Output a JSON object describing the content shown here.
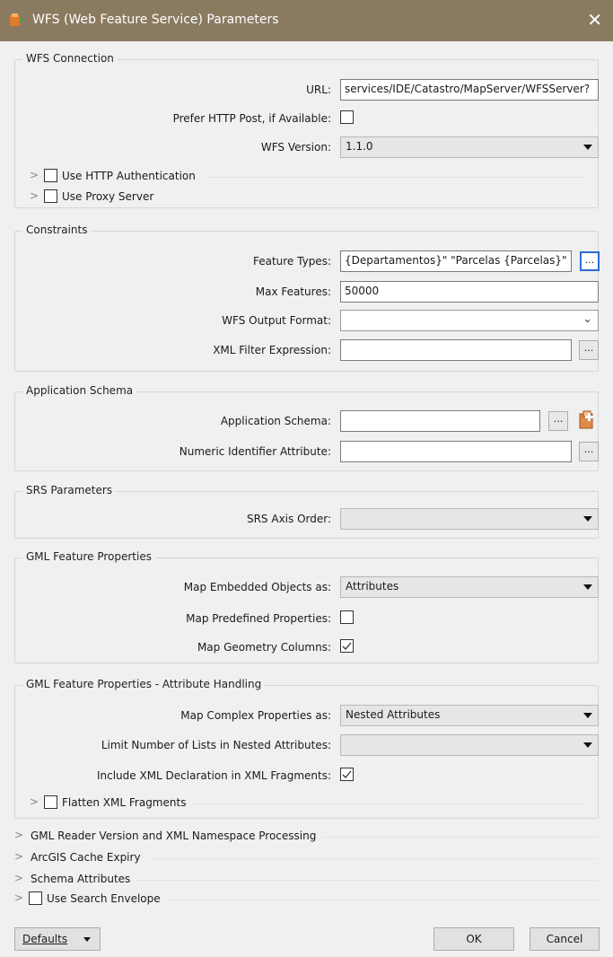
{
  "window": {
    "title": "WFS (Web Feature Service) Parameters",
    "close_glyph": "✕"
  },
  "wfs_connection": {
    "title": "WFS Connection",
    "url_label": "URL:",
    "url_value": "services/IDE/Catastro/MapServer/WFSServer?",
    "prefer_post_label": "Prefer HTTP Post, if Available:",
    "version_label": "WFS Version:",
    "version_value": "1.1.0",
    "http_auth_label": "Use HTTP Authentication",
    "proxy_label": "Use Proxy Server"
  },
  "constraints": {
    "title": "Constraints",
    "feature_types_label": "Feature Types:",
    "feature_types_value": "{Departamentos}\" \"Parcelas  {Parcelas}\"",
    "max_features_label": "Max Features:",
    "max_features_value": "50000",
    "output_format_label": "WFS Output Format:",
    "xml_filter_label": "XML Filter Expression:"
  },
  "app_schema": {
    "title": "Application Schema",
    "schema_label": "Application Schema:",
    "numeric_id_label": "Numeric Identifier Attribute:"
  },
  "srs": {
    "title": "SRS Parameters",
    "axis_order_label": "SRS Axis Order:"
  },
  "gml_props": {
    "title": "GML Feature Properties",
    "embedded_label": "Map Embedded Objects as:",
    "embedded_value": "Attributes",
    "predefined_label": "Map Predefined Properties:",
    "geom_columns_label": "Map Geometry Columns:"
  },
  "gml_attr": {
    "title": "GML Feature Properties - Attribute Handling",
    "complex_label": "Map Complex Properties as:",
    "complex_value": "Nested Attributes",
    "limit_lists_label": "Limit Number of Lists in Nested Attributes:",
    "include_xml_label": "Include XML Declaration in XML Fragments:",
    "flatten_label": "Flatten XML Fragments"
  },
  "collapsed": {
    "gml_reader": "GML Reader Version and XML Namespace Processing",
    "arcgis_cache": "ArcGIS Cache Expiry",
    "schema_attrs": "Schema Attributes",
    "search_envelope": "Use Search Envelope"
  },
  "buttons": {
    "defaults": "Defaults",
    "ok": "OK",
    "cancel": "Cancel",
    "dots": "..."
  },
  "colors": {
    "titlebar": "#8a7a60",
    "focus": "#2a6dd6"
  },
  "icons": {
    "app": "fme-workbench-icon",
    "chevron": "chevron-right-icon",
    "schema_add": "add-schema-icon"
  }
}
